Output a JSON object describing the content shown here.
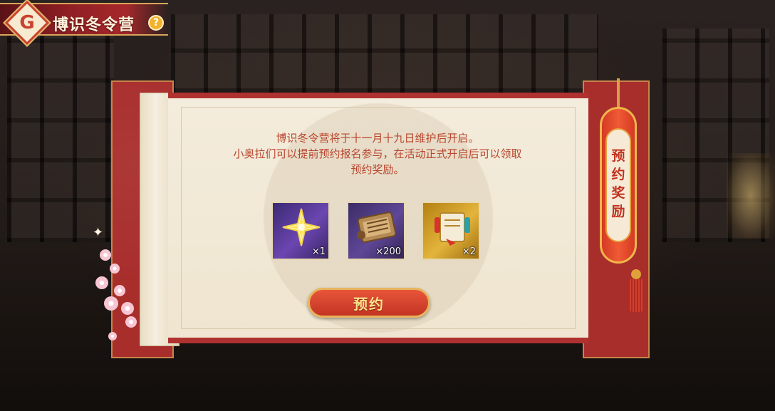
{
  "header": {
    "logo_letter": "G",
    "title": "博识冬令营",
    "help_glyph": "?"
  },
  "intro": {
    "line1": "博识冬令营将于十一月十九日维护后开启。",
    "line2": "小奥拉们可以提前预约报名参与，在活动正式开启后可以领取",
    "line3": "预约奖励。"
  },
  "rewards": [
    {
      "icon": "purple-star-icon",
      "count": "×1"
    },
    {
      "icon": "scroll-icon",
      "count": "×200"
    },
    {
      "icon": "potion-scroll-icon",
      "count": "×2"
    }
  ],
  "reserve_button": {
    "label": "预约"
  },
  "side_tag": {
    "line1": "预",
    "line2": "约",
    "line3": "奖",
    "line4": "励"
  },
  "colors": {
    "accent_red": "#c43423",
    "gold": "#e8b45c",
    "paper": "#f4ecdc",
    "text_red": "#b8472e"
  }
}
